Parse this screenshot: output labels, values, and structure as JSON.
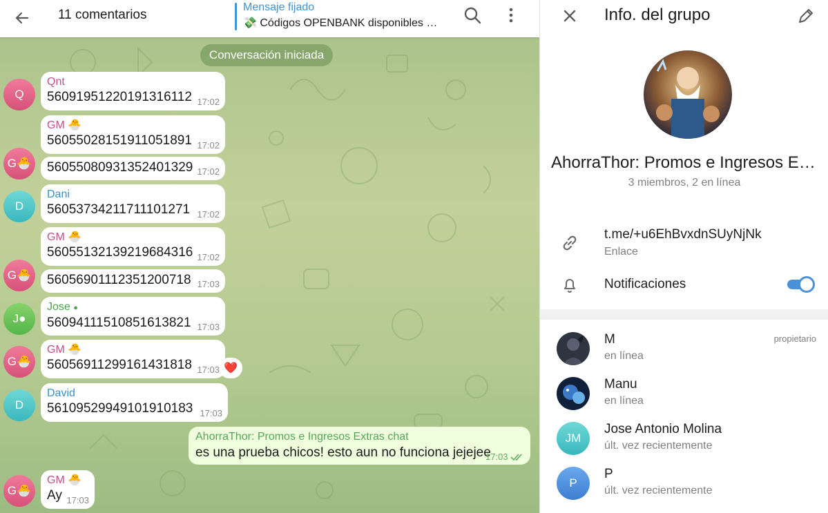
{
  "chat": {
    "header": {
      "title": "11 comentarios",
      "pinned_label": "Mensaje fijado",
      "pinned_text": "💸 Códigos OPENBANK disponibles …"
    },
    "system_message": "Conversación iniciada",
    "messages": [
      {
        "name": "Qnt",
        "text": "5609195122019131611​2",
        "time": "17:02"
      },
      {
        "name": "GM 🐣",
        "text": "5605502815191105189​1",
        "time": "17:02"
      },
      {
        "name": "",
        "text": "5605508093135240132​9",
        "time": "17:02"
      },
      {
        "name": "Dani",
        "text": "5605373421171110127​1",
        "time": "17:02"
      },
      {
        "name": "GM 🐣",
        "text": "5605513213921968431​6",
        "time": "17:02"
      },
      {
        "name": "",
        "text": "5605690111235120071​8",
        "time": "17:03"
      },
      {
        "name": "Jose ",
        "text": "5609411151085161382​1",
        "time": "17:03"
      },
      {
        "name": "GM 🐣",
        "text": "5605691129916143181​8",
        "time": "17:03"
      },
      {
        "name": "David",
        "text": "5610952994910191018​3",
        "time": "17:03"
      },
      {
        "name": "GM 🐣",
        "text": "Ay",
        "time": "17:03"
      }
    ],
    "avatars": {
      "q": "Q",
      "g": "G🐣",
      "d": "D",
      "j": "J"
    },
    "outgoing": {
      "name": "AhorraThor: Promos e Ingresos Extras chat",
      "text": "es una prueba chicos! esto aun no funciona jejejee",
      "time": "17:03"
    },
    "reaction": "❤️"
  },
  "info": {
    "title": "Info. del grupo",
    "group_name": "AhorraThor: Promos e Ingresos Extras",
    "group_sub": "3 miembros, 2 en línea",
    "link": "t.me/+u6EhBvxdnSUyNjNk",
    "link_label": "Enlace",
    "notifications_label": "Notificaciones",
    "notifications_on": true,
    "members": [
      {
        "name": "M",
        "status": "en línea",
        "role": "propietario",
        "initials": ""
      },
      {
        "name": "Manu",
        "status": "en línea",
        "role": "",
        "initials": ""
      },
      {
        "name": "Jose Antonio Molina",
        "status": "últ. vez recientemente",
        "role": "",
        "initials": "JM"
      },
      {
        "name": "P",
        "status": "últ. vez recientemente",
        "role": "",
        "initials": "P"
      }
    ]
  },
  "colors": {
    "accent": "#3e93d4",
    "toggle": "#4a91d8",
    "outgoing_bubble": "#effedd",
    "name_pink": "#c14f8f",
    "name_blue": "#3a8fc8"
  }
}
